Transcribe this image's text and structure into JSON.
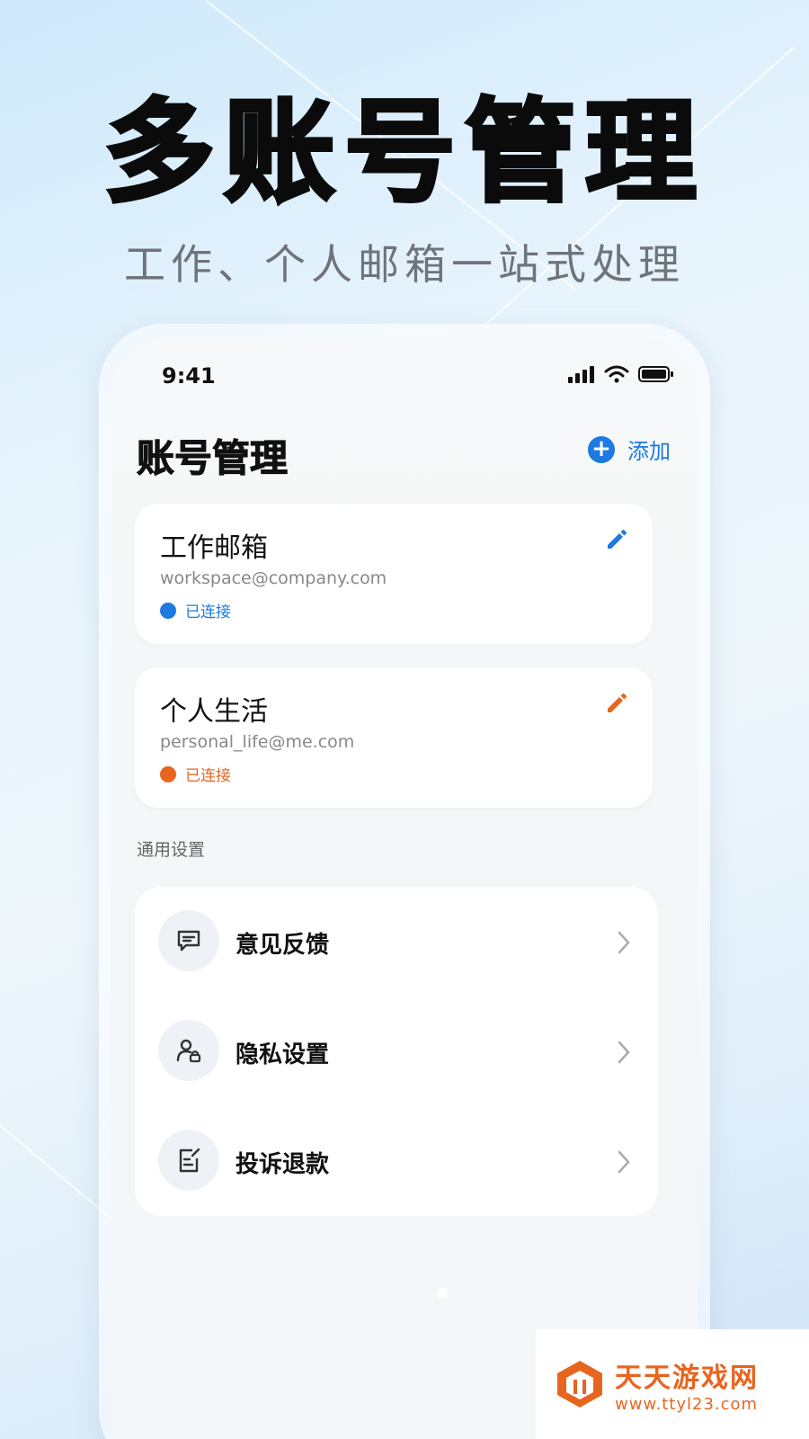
{
  "hero": {
    "title": "多账号管理",
    "subtitle": "工作、个人邮箱一站式处理"
  },
  "status_bar": {
    "time": "9:41"
  },
  "header": {
    "title": "账号管理",
    "add_label": "添加"
  },
  "accounts": [
    {
      "name": "工作邮箱",
      "email": "workspace@company.com",
      "status": "已连接",
      "color": "#1e7ae0"
    },
    {
      "name": "个人生活",
      "email": "personal_life@me.com",
      "status": "已连接",
      "color": "#e8651f"
    }
  ],
  "settings": {
    "section_label": "通用设置",
    "items": [
      {
        "label": "意见反馈",
        "icon": "message-icon"
      },
      {
        "label": "隐私设置",
        "icon": "user-lock-icon"
      },
      {
        "label": "投诉退款",
        "icon": "document-edit-icon"
      }
    ]
  },
  "watermark": {
    "title": "天天游戏网",
    "url": "www.ttyl23.com"
  },
  "colors": {
    "accent_blue": "#1e7ae0",
    "accent_orange": "#e8651f"
  }
}
